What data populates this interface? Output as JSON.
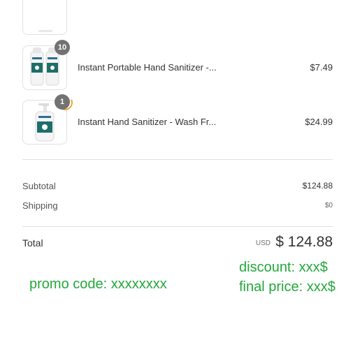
{
  "items": [
    {
      "name": "Instant Portable Hand Sanitizer -...",
      "price": "$7.49",
      "quantity": "10",
      "image": "two-small-sanitizer-bottles"
    },
    {
      "name": "Instant Hand Sanitizer - Wash Fr...",
      "price": "$24.99",
      "quantity": "1",
      "image": "pump-sanitizer-bottle"
    }
  ],
  "summary": {
    "subtotal_label": "Subtotal",
    "subtotal_value": "$124.88",
    "shipping_label": "Shipping",
    "shipping_value": "$0",
    "total_label": "Total",
    "total_currency": "USD",
    "total_value": "$ 124.88"
  },
  "annotations": {
    "promo": "promo code: xxxxxxxx",
    "discount": "discount: xxx$",
    "final": "final price: xxx$"
  },
  "colors": {
    "annotation": "#22a83a",
    "badge": "#727272",
    "brand_teal": "#1e6e6a"
  }
}
